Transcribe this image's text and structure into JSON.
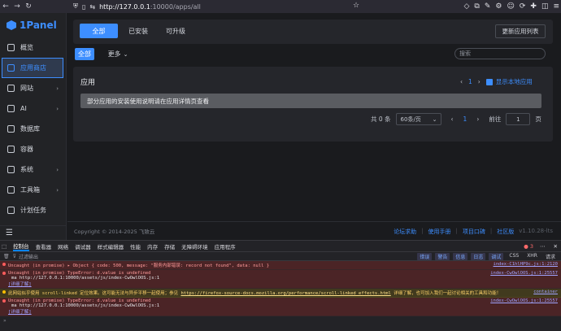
{
  "browser": {
    "url_host": "http://127.0.0.1",
    "url_rest": ":10000/apps/all"
  },
  "sidebar": {
    "logo": "1Panel",
    "items": [
      {
        "label": "概览",
        "icon": "home-icon"
      },
      {
        "label": "应用商店",
        "icon": "store-icon"
      },
      {
        "label": "网站",
        "icon": "globe-icon"
      },
      {
        "label": "AI",
        "icon": "ai-icon"
      },
      {
        "label": "数据库",
        "icon": "database-icon"
      },
      {
        "label": "容器",
        "icon": "container-icon"
      },
      {
        "label": "系统",
        "icon": "system-icon"
      },
      {
        "label": "工具箱",
        "icon": "toolbox-icon"
      },
      {
        "label": "计划任务",
        "icon": "schedule-icon"
      }
    ]
  },
  "tabs": {
    "all": "全部",
    "installed": "已安装",
    "upgradable": "可升级",
    "update_list": "更新应用列表"
  },
  "filter": {
    "all": "全部",
    "more": "更多",
    "search_placeholder": "搜索"
  },
  "apps": {
    "title": "应用",
    "page": "1",
    "show_local": "显示本地应用",
    "notice": "部分应用的安装使用说明请在应用详情页查看",
    "total": "共 0 条",
    "page_size": "60条/页",
    "goto": "前往",
    "goto_value": "1",
    "page_unit": "页"
  },
  "footer": {
    "copyright": "Copyright © 2014-2025 飞致云",
    "links": [
      "论坛求助",
      "使用手册",
      "项目口碑",
      "社区版"
    ],
    "version": "v1.10.28-lts"
  },
  "devtools": {
    "tabs": [
      "控制台",
      "查看器",
      "网络",
      "调试器",
      "样式编辑器",
      "性能",
      "内存",
      "存储",
      "无障碍环境",
      "应用程序"
    ],
    "error_count": "3",
    "filter_placeholder": "过滤输出",
    "levels": [
      "错误",
      "警告",
      "信息",
      "日志",
      "调试",
      "CSS",
      "XHR",
      "请求"
    ],
    "logs": [
      {
        "type": "error",
        "text": "Uncaught (in promise) ▸ Object { code: 500, message: \"服务内部错误: record not found\", data: null }",
        "src": "index-C1hlHP9c.js:1:2120"
      },
      {
        "type": "error",
        "text": "Uncaught (in promise) TypeError: d.value is undefined",
        "sub": "ma http://127.0.0.1:10000/assets/js/index-CwOwlOOS.js:1",
        "learn": "[详细了解]",
        "src": "index-CwOwlOOS.js:1:25557"
      },
      {
        "type": "warn",
        "text": "此网站似乎使用 scroll-linked 定位效果。这可能无法与异步平移一起使用；参见",
        "link": "https://firefox-source-docs.mozilla.org/performance/scroll-linked_effects.html",
        "tail": "详细了解，也可加入我们一起讨论相关的工具和功能！",
        "src": "container"
      },
      {
        "type": "error",
        "text": "Uncaught (in promise) TypeError: d.value is undefined",
        "sub": "ma http://127.0.0.1:10000/assets/js/index-CwOwlOOS.js:1",
        "learn": "[详细了解]",
        "src": "index-CwOwlOOS.js:1:25557"
      }
    ]
  }
}
